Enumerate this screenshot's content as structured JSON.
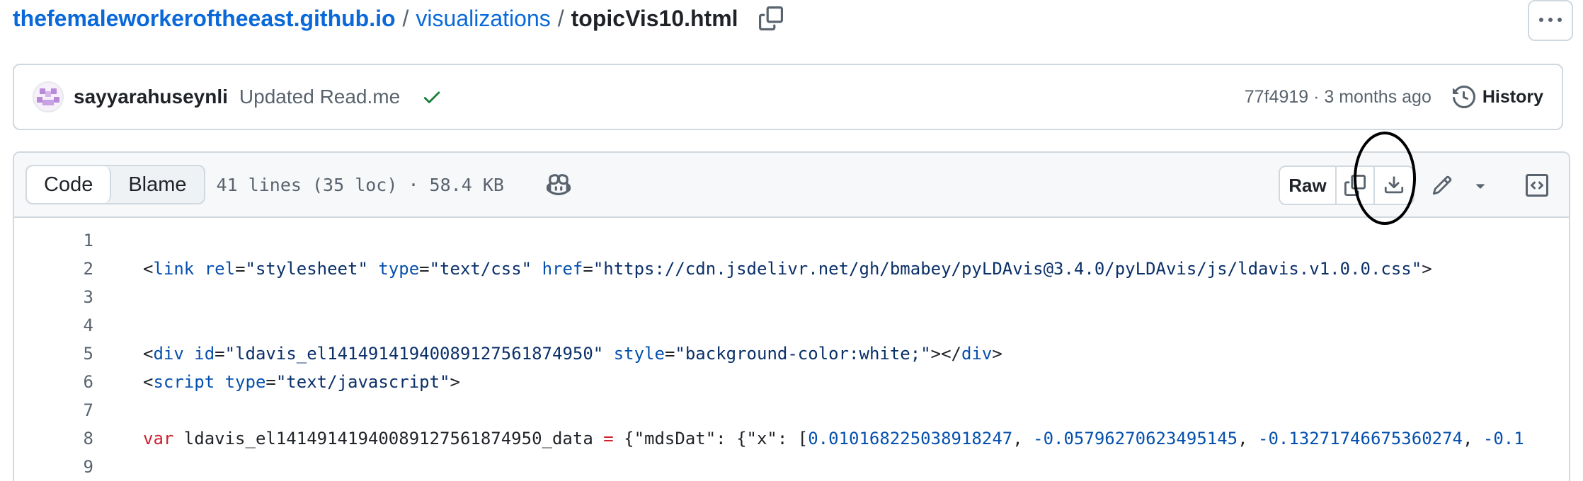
{
  "breadcrumb": {
    "repo": "thefemaleworkeroftheeast.github.io",
    "sep1": "/",
    "folder": "visualizations",
    "sep2": "/",
    "file": "topicVis10.html"
  },
  "commit": {
    "author": "sayyarahuseynli",
    "message": "Updated Read.me",
    "meta": "77f4919 · 3 months ago",
    "history_label": "History"
  },
  "file_header": {
    "tab_code": "Code",
    "tab_blame": "Blame",
    "info": "41 lines (35 loc) · 58.4 KB",
    "raw_label": "Raw"
  },
  "code_lines": [
    {
      "n": "1"
    },
    {
      "n": "2",
      "p": [
        "<",
        "link",
        " ",
        "rel",
        "=",
        "\"stylesheet\"",
        " ",
        "type",
        "=",
        "\"text/css\"",
        " ",
        "href",
        "=",
        "\"https://cdn.jsdelivr.net/gh/bmabey/pyLDAvis@3.4.0/pyLDAvis/js/ldavis.v1.0.0.css\"",
        ">"
      ]
    },
    {
      "n": "3"
    },
    {
      "n": "4"
    },
    {
      "n": "5",
      "p": [
        "<",
        "div",
        " ",
        "id",
        "=",
        "\"ldavis_el14149141940089127561874950\"",
        " ",
        "style",
        "=",
        "\"background-color:white;\"",
        "></",
        "div",
        ">"
      ]
    },
    {
      "n": "6",
      "p": [
        "<",
        "script",
        " ",
        "type",
        "=",
        "\"text/javascript\"",
        ">"
      ]
    },
    {
      "n": "7"
    },
    {
      "n": "8",
      "p": [
        "var",
        " ldavis_el14149141940089127561874950_data ",
        "=",
        " {\"mdsDat\": {\"x\": [",
        "0.010168225038918247",
        ", ",
        "-0.05796270623495145",
        ", ",
        "-0.13271746675360274",
        ", ",
        "-0.1"
      ]
    },
    {
      "n": "9"
    }
  ],
  "colors": {
    "link": "#0969da",
    "keyword": "#cf222e",
    "string": "#0a3069",
    "tag": "#0550ae",
    "success": "#1a7f37"
  }
}
